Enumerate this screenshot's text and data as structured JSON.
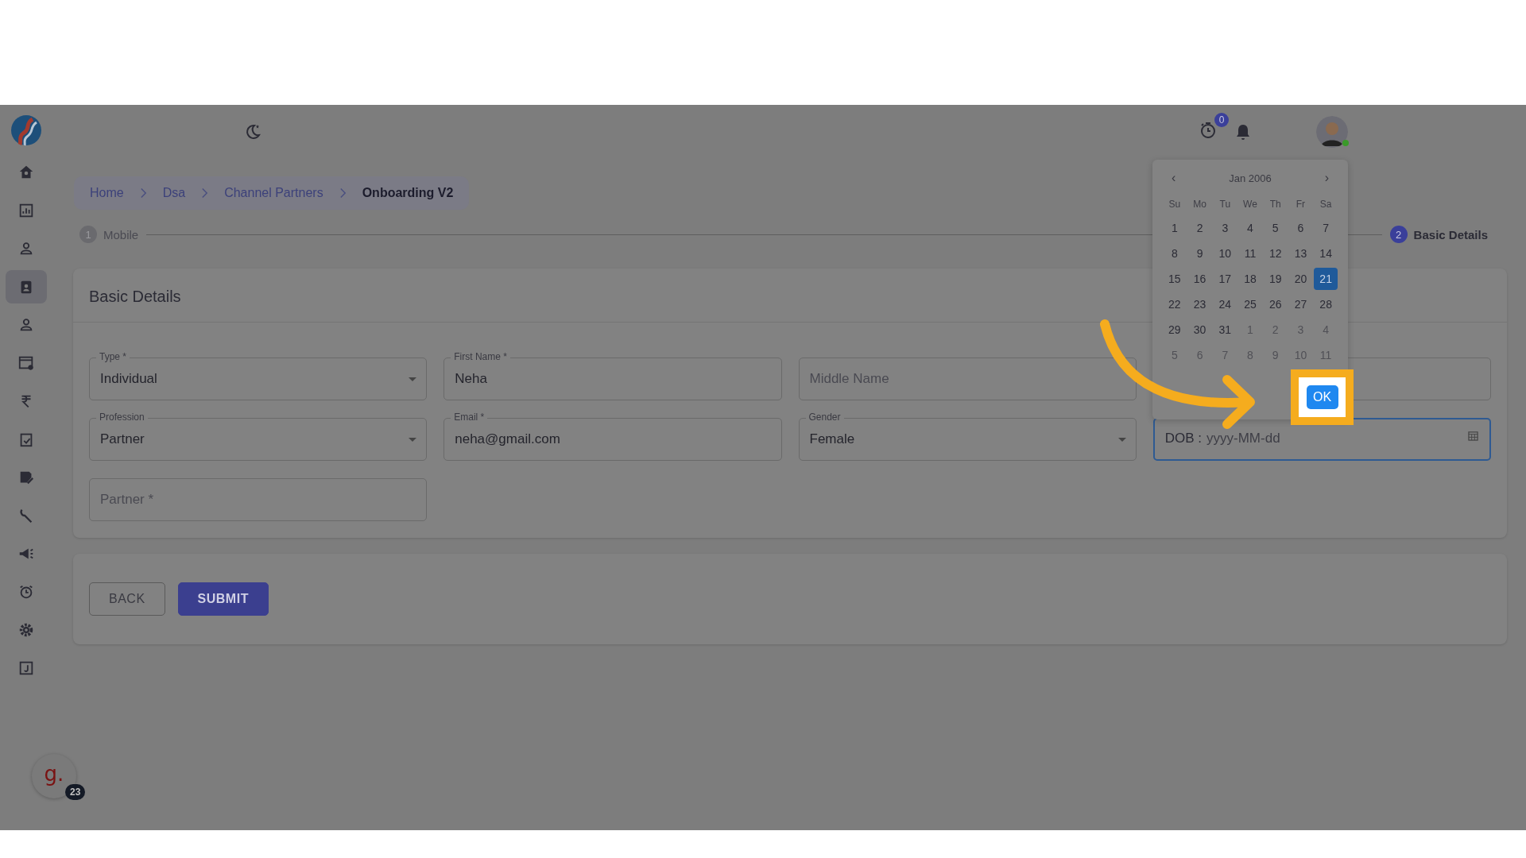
{
  "topbar": {
    "timer_badge": "0"
  },
  "breadcrumb": [
    "Home",
    "Dsa",
    "Channel Partners",
    "Onboarding V2"
  ],
  "sidebar": {
    "items": [
      {
        "selected": false
      },
      {
        "selected": false
      },
      {
        "selected": false
      },
      {
        "selected": true
      },
      {
        "selected": false
      },
      {
        "selected": false
      },
      {
        "selected": false
      },
      {
        "selected": false
      },
      {
        "selected": false
      },
      {
        "selected": false
      },
      {
        "selected": false
      },
      {
        "selected": false
      },
      {
        "selected": false
      },
      {
        "selected": false
      }
    ]
  },
  "stepper": [
    {
      "number": "1",
      "label": "Mobile",
      "active": false
    },
    {
      "number": "2",
      "label": "Basic Details",
      "active": true
    }
  ],
  "form": {
    "title": "Basic Details",
    "fields": [
      {
        "kind": "select",
        "label": "Type *",
        "value": "Individual"
      },
      {
        "kind": "text",
        "label": "First Name *",
        "value": "Neha"
      },
      {
        "kind": "text",
        "placeholder": "Middle Name"
      },
      {
        "kind": "blank"
      },
      {
        "kind": "select",
        "label": "Profession",
        "value": "Partner"
      },
      {
        "kind": "text",
        "label": "Email *",
        "value": "neha@gmail.com"
      },
      {
        "kind": "select",
        "label": "Gender",
        "value": "Female"
      },
      {
        "kind": "date",
        "label": "DOB :",
        "placeholder": "yyyy-MM-dd",
        "focused": true
      },
      {
        "kind": "text",
        "placeholder": "Partner *"
      }
    ]
  },
  "actions": [
    {
      "label": "BACK",
      "kind": "outlined"
    },
    {
      "label": "SUBMIT",
      "kind": "filled"
    }
  ],
  "calendar": {
    "month": "Jan 2006",
    "prev": "‹",
    "next": "›",
    "weekdays": [
      "Su",
      "Mo",
      "Tu",
      "We",
      "Th",
      "Fr",
      "Sa"
    ],
    "days": [
      {
        "label": "1",
        "outside": false,
        "selected": false
      },
      {
        "label": "2",
        "outside": false,
        "selected": false
      },
      {
        "label": "3",
        "outside": false,
        "selected": false
      },
      {
        "label": "4",
        "outside": false,
        "selected": false
      },
      {
        "label": "5",
        "outside": false,
        "selected": false
      },
      {
        "label": "6",
        "outside": false,
        "selected": false
      },
      {
        "label": "7",
        "outside": false,
        "selected": false
      },
      {
        "label": "8",
        "outside": false,
        "selected": false
      },
      {
        "label": "9",
        "outside": false,
        "selected": false
      },
      {
        "label": "10",
        "outside": false,
        "selected": false
      },
      {
        "label": "11",
        "outside": false,
        "selected": false
      },
      {
        "label": "12",
        "outside": false,
        "selected": false
      },
      {
        "label": "13",
        "outside": false,
        "selected": false
      },
      {
        "label": "14",
        "outside": false,
        "selected": false
      },
      {
        "label": "15",
        "outside": false,
        "selected": false
      },
      {
        "label": "16",
        "outside": false,
        "selected": false
      },
      {
        "label": "17",
        "outside": false,
        "selected": false
      },
      {
        "label": "18",
        "outside": false,
        "selected": false
      },
      {
        "label": "19",
        "outside": false,
        "selected": false
      },
      {
        "label": "20",
        "outside": false,
        "selected": false
      },
      {
        "label": "21",
        "outside": false,
        "selected": true
      },
      {
        "label": "22",
        "outside": false,
        "selected": false
      },
      {
        "label": "23",
        "outside": false,
        "selected": false
      },
      {
        "label": "24",
        "outside": false,
        "selected": false
      },
      {
        "label": "25",
        "outside": false,
        "selected": false
      },
      {
        "label": "26",
        "outside": false,
        "selected": false
      },
      {
        "label": "27",
        "outside": false,
        "selected": false
      },
      {
        "label": "28",
        "outside": false,
        "selected": false
      },
      {
        "label": "29",
        "outside": false,
        "selected": false
      },
      {
        "label": "30",
        "outside": false,
        "selected": false
      },
      {
        "label": "31",
        "outside": false,
        "selected": false
      },
      {
        "label": "1",
        "outside": true,
        "selected": false
      },
      {
        "label": "2",
        "outside": true,
        "selected": false
      },
      {
        "label": "3",
        "outside": true,
        "selected": false
      },
      {
        "label": "4",
        "outside": true,
        "selected": false
      },
      {
        "label": "5",
        "outside": true,
        "selected": false
      },
      {
        "label": "6",
        "outside": true,
        "selected": false
      },
      {
        "label": "7",
        "outside": true,
        "selected": false
      },
      {
        "label": "8",
        "outside": true,
        "selected": false
      },
      {
        "label": "9",
        "outside": true,
        "selected": false
      },
      {
        "label": "10",
        "outside": true,
        "selected": false
      },
      {
        "label": "11",
        "outside": true,
        "selected": false
      }
    ],
    "ok": "OK"
  },
  "chat": {
    "logo": "g.",
    "badge": "23"
  }
}
